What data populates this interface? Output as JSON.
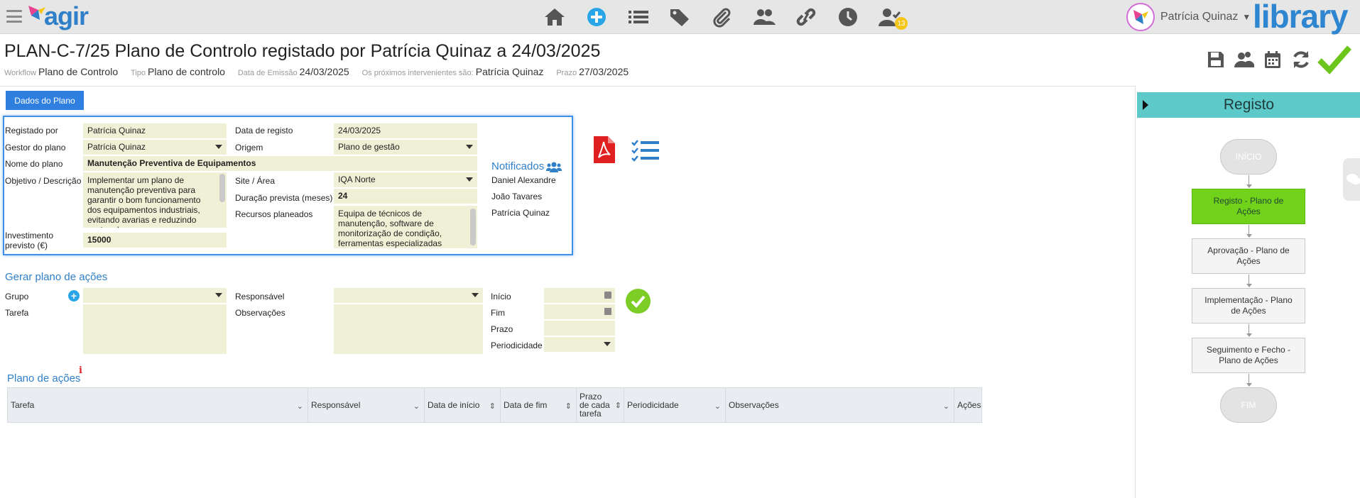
{
  "header": {
    "logo_text": "agir",
    "nav_icons": [
      "home-icon",
      "add-icon",
      "list-icon",
      "tags-icon",
      "paperclip-icon",
      "users-icon",
      "link-icon",
      "clock-icon",
      "user-check-icon"
    ],
    "notification_count": "13",
    "user_name": "Patrícia Quinaz",
    "library_logo": "library"
  },
  "page": {
    "title": "PLAN-C-7/25 Plano de Controlo registado por Patrícia Quinaz a 24/03/2025",
    "meta": [
      {
        "key": "Workflow",
        "value": "Plano de Controlo"
      },
      {
        "key": "Tipo",
        "value": "Plano de controlo"
      },
      {
        "key": "Data de Emissão",
        "value": "24/03/2025"
      },
      {
        "key": "Os próximos intervenientes são:",
        "value": "Patrícia Quinaz"
      },
      {
        "key": "Prazo",
        "value": "27/03/2025"
      }
    ],
    "actions": [
      "save-icon",
      "participants-icon",
      "calendar-icon",
      "refresh-icon",
      "confirm-check-icon"
    ]
  },
  "tab": {
    "label": "Dados do Plano"
  },
  "form": {
    "registado_por": {
      "label": "Registado por",
      "value": "Patrícia Quinaz"
    },
    "gestor": {
      "label": "Gestor do plano",
      "value": "Patrícia Quinaz"
    },
    "nome": {
      "label": "Nome do plano",
      "value": "Manutenção Preventiva de Equipamentos"
    },
    "objetivo": {
      "label": "Objetivo / Descrição",
      "value": "Implementar um plano de manutenção preventiva para garantir o bom funcionamento dos equipamentos industriais, evitando avarias e reduzindo custos de"
    },
    "investimento": {
      "label": "Investimento previsto (€)",
      "value": "15000"
    },
    "data_registo": {
      "label": "Data de registo",
      "value": "24/03/2025"
    },
    "origem": {
      "label": "Origem",
      "value": "Plano de gestão"
    },
    "site": {
      "label": "Site / Área",
      "value": "IQA Norte"
    },
    "duracao": {
      "label": "Duração prevista (meses)",
      "value": "24"
    },
    "recursos": {
      "label": "Recursos planeados",
      "value": "Equipa de técnicos de manutenção, software de monitorização de condição, ferramentas especializadas"
    },
    "notificados": {
      "title": "Notificados",
      "people": [
        "Daniel Alexandre",
        "João Tavares",
        "Patrícia Quinaz"
      ]
    }
  },
  "gerar": {
    "title": "Gerar plano de ações",
    "grupo": "Grupo",
    "tarefa": "Tarefa",
    "responsavel": "Responsável",
    "observacoes": "Observações",
    "inicio": "Início",
    "fim": "Fim",
    "prazo": "Prazo",
    "periodicidade": "Periodicidade"
  },
  "plano": {
    "title": "Plano de ações",
    "info": "i",
    "columns": [
      "Tarefa",
      "Responsável",
      "Data de início",
      "Data de fim",
      "Prazo de cada tarefa",
      "Periodicidade",
      "Observações",
      "Ações"
    ]
  },
  "workflow": {
    "header": "Registo",
    "start": "INÍCIO",
    "steps": [
      "Registo - Plano de Ações",
      "Aprovação - Plano de Ações",
      "Implementação - Plano de Ações",
      "Seguimento e Fecho - Plano de Ações"
    ],
    "end": "FIM",
    "active_color": "#71d319"
  },
  "colors": {
    "accent": "#2f80c9",
    "field_bg": "#f0f0d6",
    "panel_header": "#5ec9c9"
  }
}
